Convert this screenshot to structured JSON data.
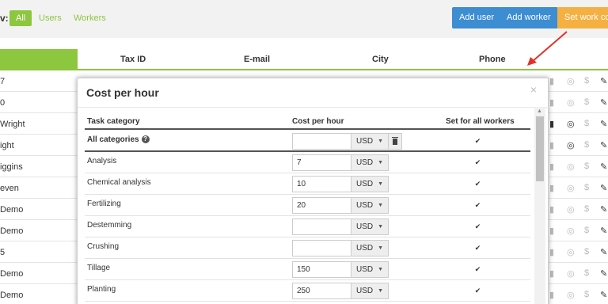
{
  "filter": {
    "label": "v:",
    "all": "All",
    "users": "Users",
    "workers": "Workers"
  },
  "buttons": {
    "add_user": "Add user",
    "add_worker": "Add worker",
    "set_work_cost": "Set work cos"
  },
  "table_header": {
    "tax_id": "Tax ID",
    "email": "E-mail",
    "city": "City",
    "phone": "Phone"
  },
  "rows": [
    {
      "name": "7"
    },
    {
      "name": "0"
    },
    {
      "name": "Wright"
    },
    {
      "name": "ight"
    },
    {
      "name": "iggins"
    },
    {
      "name": "even"
    },
    {
      "name": "Demo"
    },
    {
      "name": "Demo"
    },
    {
      "name": "5"
    },
    {
      "name": " Demo"
    },
    {
      "name": " Demo"
    }
  ],
  "modal": {
    "title": "Cost per hour",
    "close": "×",
    "headers": {
      "category": "Task category",
      "cost": "Cost per hour",
      "set_all": "Set for all workers"
    },
    "all_categories": {
      "label": "All categories",
      "value": "",
      "currency": "USD"
    },
    "rows": [
      {
        "category": "Analysis",
        "cost": "7",
        "currency": "USD"
      },
      {
        "category": "Chemical analysis",
        "cost": "10",
        "currency": "USD"
      },
      {
        "category": "Fertilizing",
        "cost": "20",
        "currency": "USD"
      },
      {
        "category": "Destemming",
        "cost": "",
        "currency": "USD"
      },
      {
        "category": "Crushing",
        "cost": "",
        "currency": "USD"
      },
      {
        "category": "Tillage",
        "cost": "150",
        "currency": "USD"
      },
      {
        "category": "Planting",
        "cost": "250",
        "currency": "USD"
      }
    ]
  },
  "colors": {
    "accent_green": "#8dc63f",
    "button_blue": "#3c8dd2",
    "button_orange": "#f5b042",
    "arrow_red": "#e0322b"
  }
}
